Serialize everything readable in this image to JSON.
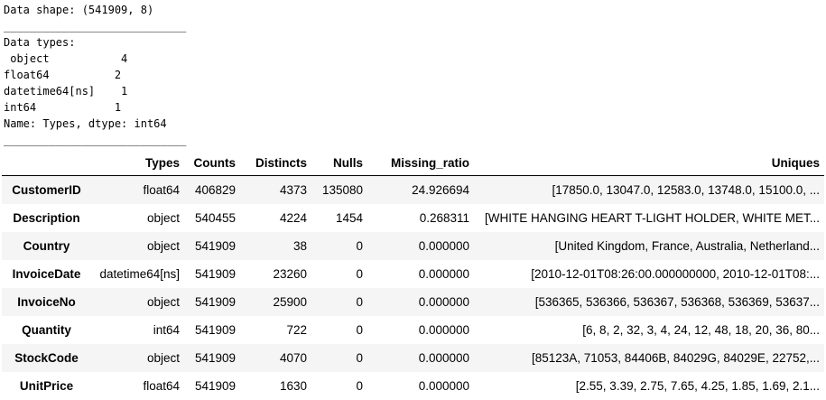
{
  "output_lines": [
    "Data shape: (541909, 8)",
    "____________________________",
    "Data types:",
    " object           4",
    "float64          2",
    "datetime64[ns]    1",
    "int64            1",
    "Name: Types, dtype: int64",
    "____________________________"
  ],
  "table": {
    "columns": [
      "",
      "Types",
      "Counts",
      "Distincts",
      "Nulls",
      "Missing_ratio",
      "Uniques"
    ],
    "rows": [
      {
        "index": "CustomerID",
        "cells": [
          "float64",
          "406829",
          "4373",
          "135080",
          "24.926694",
          "[17850.0, 13047.0, 12583.0, 13748.0, 15100.0, ..."
        ]
      },
      {
        "index": "Description",
        "cells": [
          "object",
          "540455",
          "4224",
          "1454",
          "0.268311",
          "[WHITE HANGING HEART T-LIGHT HOLDER, WHITE MET..."
        ]
      },
      {
        "index": "Country",
        "cells": [
          "object",
          "541909",
          "38",
          "0",
          "0.000000",
          "[United Kingdom, France, Australia, Netherland..."
        ]
      },
      {
        "index": "InvoiceDate",
        "cells": [
          "datetime64[ns]",
          "541909",
          "23260",
          "0",
          "0.000000",
          "[2010-12-01T08:26:00.000000000, 2010-12-01T08:..."
        ]
      },
      {
        "index": "InvoiceNo",
        "cells": [
          "object",
          "541909",
          "25900",
          "0",
          "0.000000",
          "[536365, 536366, 536367, 536368, 536369, 53637..."
        ]
      },
      {
        "index": "Quantity",
        "cells": [
          "int64",
          "541909",
          "722",
          "0",
          "0.000000",
          "[6, 8, 2, 32, 3, 4, 24, 12, 48, 18, 20, 36, 80..."
        ]
      },
      {
        "index": "StockCode",
        "cells": [
          "object",
          "541909",
          "4070",
          "0",
          "0.000000",
          "[85123A, 71053, 84406B, 84029G, 84029E, 22752,..."
        ]
      },
      {
        "index": "UnitPrice",
        "cells": [
          "float64",
          "541909",
          "1630",
          "0",
          "0.000000",
          "[2.55, 3.39, 2.75, 7.65, 4.25, 1.85, 1.69, 2.1..."
        ]
      }
    ]
  }
}
